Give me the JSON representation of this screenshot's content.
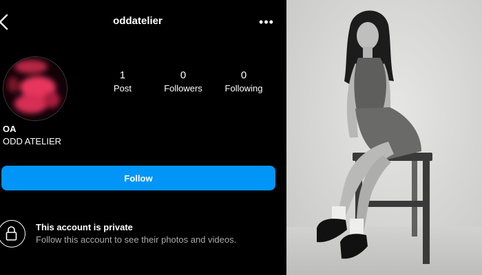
{
  "header": {
    "username": "oddatelier",
    "back_icon": "chevron-left-icon",
    "more_icon": "more-horizontal-icon"
  },
  "stats": [
    {
      "value": "1",
      "label": "Post"
    },
    {
      "value": "0",
      "label": "Followers"
    },
    {
      "value": "0",
      "label": "Following"
    }
  ],
  "profile": {
    "display_name": "OA",
    "bio": "ODD ATELIER"
  },
  "follow_button": {
    "label": "Follow"
  },
  "private_notice": {
    "title": "This account is private",
    "subtitle": "Follow this account to see their photos and videos.",
    "icon": "lock-icon"
  },
  "colors": {
    "background": "#000000",
    "accent": "#0095f6",
    "avatar": "#e8365d"
  }
}
